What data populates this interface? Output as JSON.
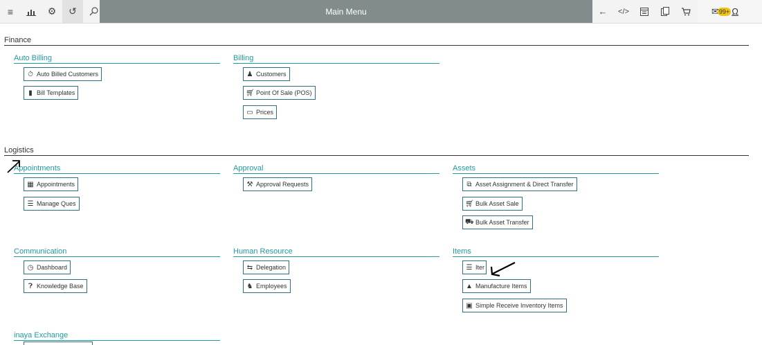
{
  "topbar": {
    "title": "Main Menu",
    "left_icons": [
      "menu-icon",
      "chart-icon",
      "settings-icon",
      "history-icon",
      "search-icon"
    ],
    "right_icons": [
      "back-arrow-icon",
      "code-icon",
      "calendar-icon",
      "clipboard-icon",
      "cart-icon"
    ],
    "notification_count": "99+"
  },
  "sections": {
    "finance": "Finance",
    "logistics": "Logistics"
  },
  "groups": {
    "auto_billing": {
      "title": "Auto Billing",
      "items": [
        "Auto Billed Customers",
        "Bill Templates"
      ]
    },
    "billing": {
      "title": "Billing",
      "items": [
        "Customers",
        "Point Of Sale (POS)",
        "Prices"
      ]
    },
    "appointments": {
      "title": "Appointments",
      "items": [
        "Appointments",
        "Manage Ques"
      ]
    },
    "approval": {
      "title": "Approval",
      "items": [
        "Approval Requests"
      ]
    },
    "assets": {
      "title": "Assets",
      "items": [
        "Asset Assignment & Direct Transfer",
        "Bulk Asset Sale",
        "Bulk Asset Transfer"
      ]
    },
    "communication": {
      "title": "Communication",
      "items": [
        "Dashboard",
        "Knowledge Base"
      ]
    },
    "human_resource": {
      "title": "Human Resource",
      "items": [
        "Delegation",
        "Employees"
      ]
    },
    "items": {
      "title": "Items",
      "items": [
        "Iter",
        "Manufacture Items",
        "Simple Receive Inventory Items"
      ]
    },
    "inaya_exchange": {
      "title": "inaya Exchange"
    }
  },
  "colors": {
    "accent": "#1f9aa0",
    "button_border": "#2e6f85",
    "header_bar": "#828c8c",
    "badge": "#f1c40f"
  }
}
